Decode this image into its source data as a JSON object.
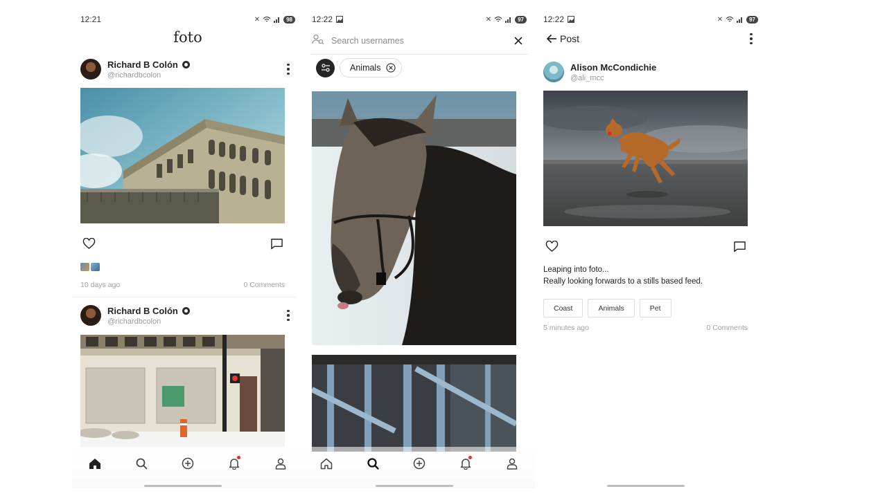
{
  "screens": [
    {
      "status": {
        "time": "12:21",
        "battery": "98"
      },
      "app_title": "foto",
      "posts": [
        {
          "name": "Richard B Colón",
          "handle": "@richardbcolon",
          "age": "10 days ago",
          "comments": "0 Comments"
        },
        {
          "name": "Richard B Colón",
          "handle": "@richardbcolon"
        }
      ]
    },
    {
      "status": {
        "time": "12:22",
        "battery": "97"
      },
      "search": {
        "placeholder": "Search usernames"
      },
      "filter_chip": {
        "label": "Animals"
      }
    },
    {
      "status": {
        "time": "12:22",
        "battery": "97"
      },
      "title": "Post",
      "post": {
        "name": "Alison McCondichie",
        "handle": "@ali_mcc",
        "caption_line1": "Leaping into foto...",
        "caption_line2": "Really looking forwards to a stills based feed.",
        "tags": [
          "Coast",
          "Animals",
          "Pet"
        ],
        "age": "5 minutes ago",
        "comments": "0 Comments"
      }
    }
  ],
  "icons": {
    "nav": [
      "home-icon",
      "search-icon",
      "add-circle-icon",
      "bell-icon",
      "profile-icon"
    ],
    "post_actions": [
      "heart-icon",
      "comment-icon"
    ]
  },
  "colors": {
    "notification_dot": "#e22b2b",
    "accent": "#262626"
  }
}
